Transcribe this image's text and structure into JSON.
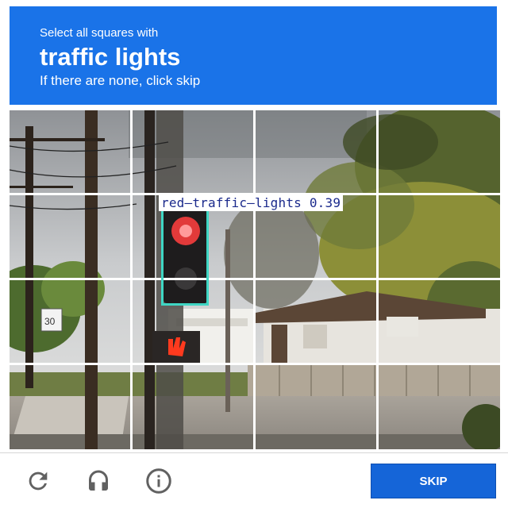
{
  "header": {
    "instruction_pre": "Select all squares with",
    "target": "traffic lights",
    "instruction_post": "If there are none, click skip"
  },
  "grid": {
    "rows": 4,
    "cols": 4
  },
  "detection": {
    "label": "red—traffic—lights 0.39"
  },
  "footer": {
    "skip_label": "SKIP",
    "icons": [
      "reload-icon",
      "audio-headphones-icon",
      "info-icon"
    ]
  },
  "colors": {
    "header_bg": "#1a73e8",
    "button_bg": "#1565d8",
    "detection_box": "#3fd6c4",
    "detection_text": "#1b2a8c"
  }
}
